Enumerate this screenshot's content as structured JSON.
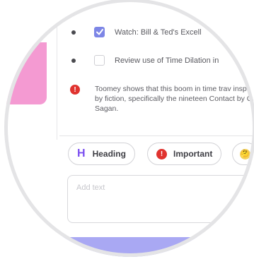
{
  "tasks": [
    {
      "text": "Watch: Bill & Ted's Excell",
      "checked": true
    },
    {
      "text": "Review use of Time Dilation in",
      "checked": false
    }
  ],
  "alert": {
    "icon": "!",
    "text": "Toomey shows that this boom in time trav inspired by fiction, specifically the nineteen Contact by Carl Sagan."
  },
  "blocks": {
    "heading_glyph": "H",
    "heading_label": "Heading",
    "important_glyph": "!",
    "important_label": "Important",
    "emoji_glyph": "🤔"
  },
  "editor": {
    "placeholder": "Add text"
  },
  "colors": {
    "accent_purple": "#7b4ff0",
    "checkbox_blue": "#7d86e6",
    "alert_red": "#e0332f",
    "pink_panel": "#f49ad2",
    "bottom_bar": "#a9a8f3"
  }
}
